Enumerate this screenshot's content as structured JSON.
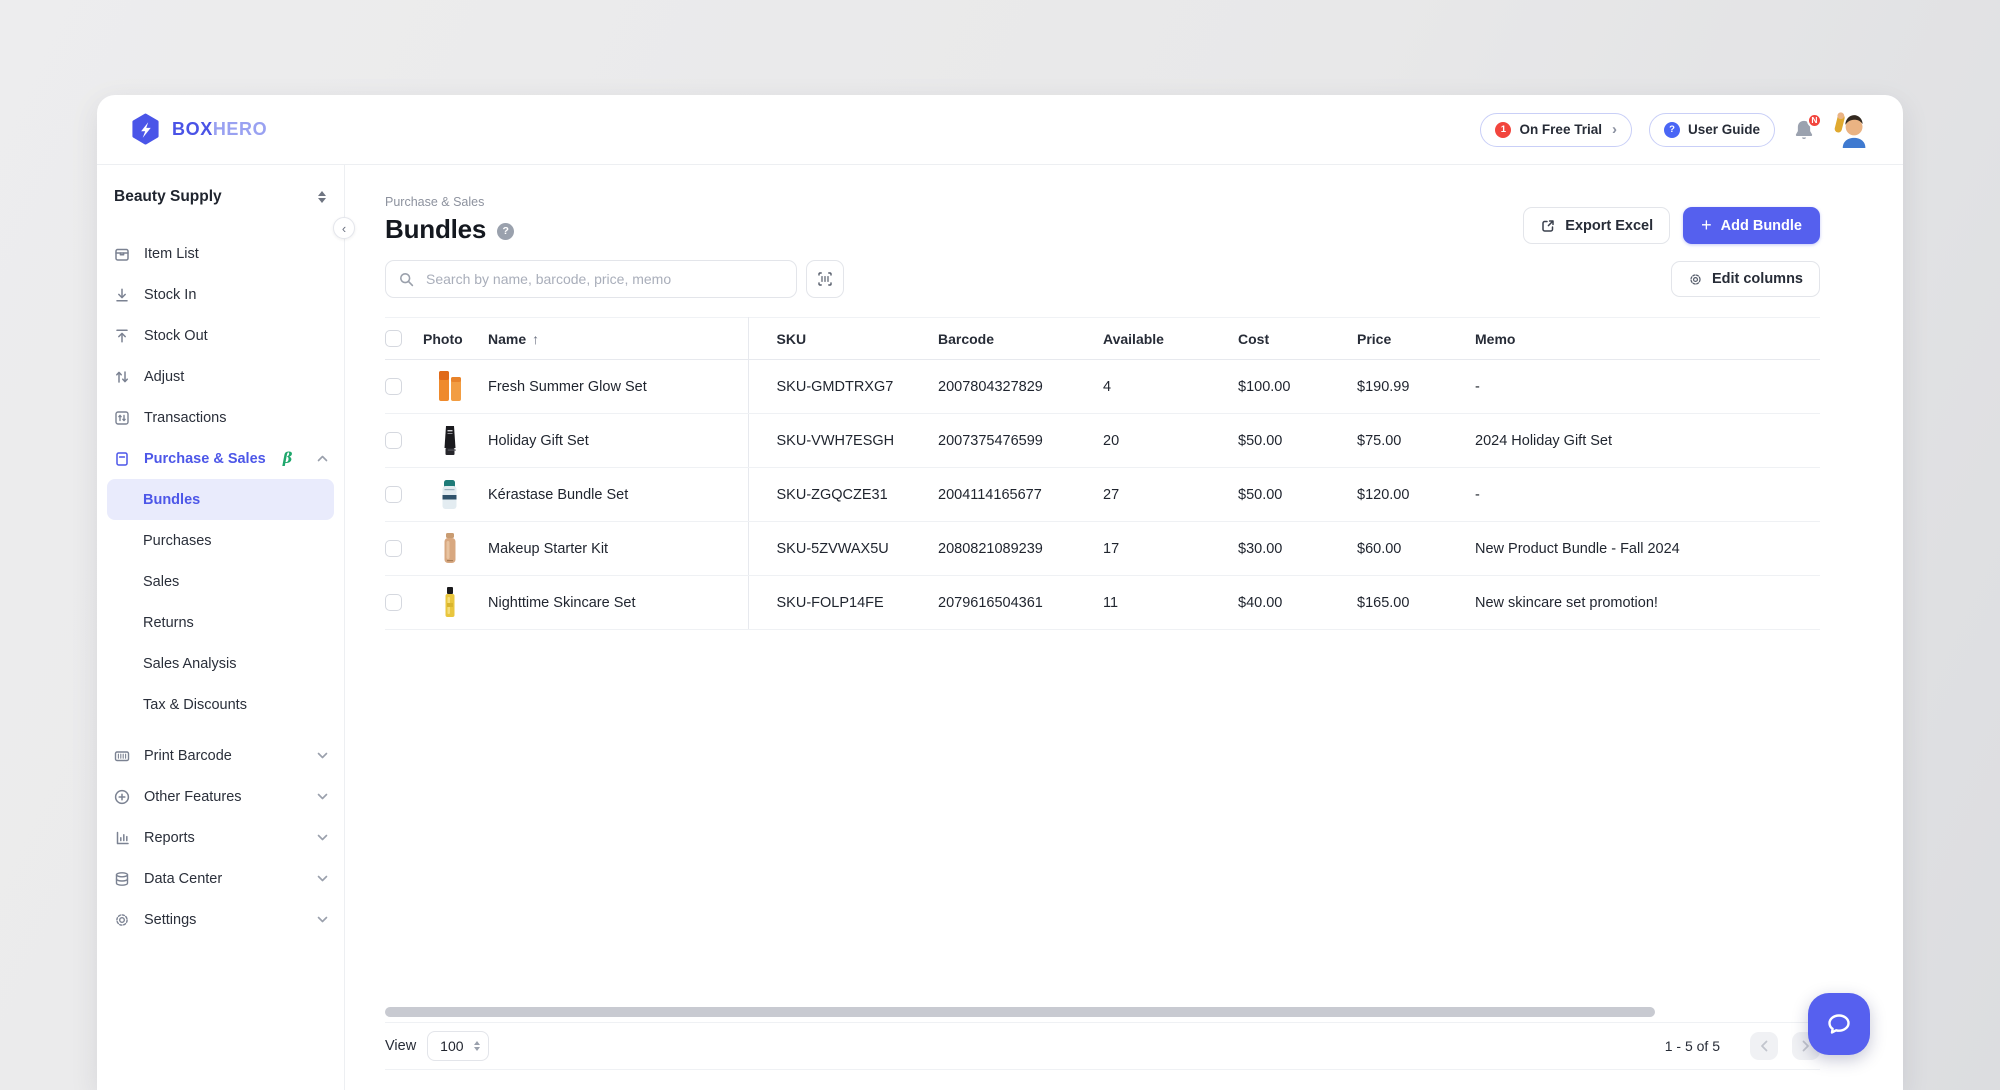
{
  "brand": {
    "box": "BOX",
    "hero": "HERO"
  },
  "topbar": {
    "trial_label": "On Free Trial",
    "trial_badge": "1",
    "user_guide_label": "User Guide",
    "bell_badge": "N"
  },
  "sidebar": {
    "workspace": "Beauty Supply",
    "items": [
      {
        "label": "Item List",
        "icon": "item-list-icon"
      },
      {
        "label": "Stock In",
        "icon": "stock-in-icon"
      },
      {
        "label": "Stock Out",
        "icon": "stock-out-icon"
      },
      {
        "label": "Adjust",
        "icon": "adjust-icon"
      },
      {
        "label": "Transactions",
        "icon": "transactions-icon"
      },
      {
        "label": "Purchase & Sales",
        "icon": "purchase-sales-icon",
        "beta": "β"
      }
    ],
    "subitems": [
      {
        "label": "Bundles"
      },
      {
        "label": "Purchases"
      },
      {
        "label": "Sales"
      },
      {
        "label": "Returns"
      },
      {
        "label": "Sales Analysis"
      },
      {
        "label": "Tax & Discounts"
      }
    ],
    "groups": [
      {
        "label": "Print Barcode",
        "icon": "print-barcode-icon"
      },
      {
        "label": "Other Features",
        "icon": "other-features-icon"
      },
      {
        "label": "Reports",
        "icon": "reports-icon"
      },
      {
        "label": "Data Center",
        "icon": "data-center-icon"
      },
      {
        "label": "Settings",
        "icon": "settings-icon"
      }
    ]
  },
  "page": {
    "breadcrumb": "Purchase & Sales",
    "title": "Bundles"
  },
  "actions": {
    "export_label": "Export Excel",
    "add_label": "Add Bundle",
    "edit_columns_label": "Edit columns"
  },
  "search": {
    "placeholder": "Search by name, barcode, price, memo"
  },
  "table": {
    "columns": [
      "Photo",
      "Name",
      "SKU",
      "Barcode",
      "Available",
      "Cost",
      "Price",
      "Memo"
    ],
    "rows": [
      {
        "name": "Fresh Summer Glow Set",
        "sku": "SKU-GMDTRXG7",
        "barcode": "2007804327829",
        "available": "4",
        "cost": "$100.00",
        "price": "$190.99",
        "memo": "-"
      },
      {
        "name": "Holiday Gift Set",
        "sku": "SKU-VWH7ESGH",
        "barcode": "2007375476599",
        "available": "20",
        "cost": "$50.00",
        "price": "$75.00",
        "memo": "2024 Holiday Gift Set"
      },
      {
        "name": "Kérastase Bundle Set",
        "sku": "SKU-ZGQCZE31",
        "barcode": "2004114165677",
        "available": "27",
        "cost": "$50.00",
        "price": "$120.00",
        "memo": "-"
      },
      {
        "name": "Makeup Starter Kit",
        "sku": "SKU-5ZVWAX5U",
        "barcode": "2080821089239",
        "available": "17",
        "cost": "$30.00",
        "price": "$60.00",
        "memo": "New Product Bundle - Fall 2024"
      },
      {
        "name": "Nighttime Skincare Set",
        "sku": "SKU-FOLP14FE",
        "barcode": "2079616504361",
        "available": "11",
        "cost": "$40.00",
        "price": "$165.00",
        "memo": "New skincare set promotion!"
      }
    ]
  },
  "footer": {
    "view_label": "View",
    "view_value": "100",
    "range": "1 - 5 of 5"
  },
  "colors": {
    "accent": "#5560ee",
    "accent_light": "#e9ebfc",
    "badge_red": "#f2453d",
    "beta_green": "#1fa76c"
  }
}
